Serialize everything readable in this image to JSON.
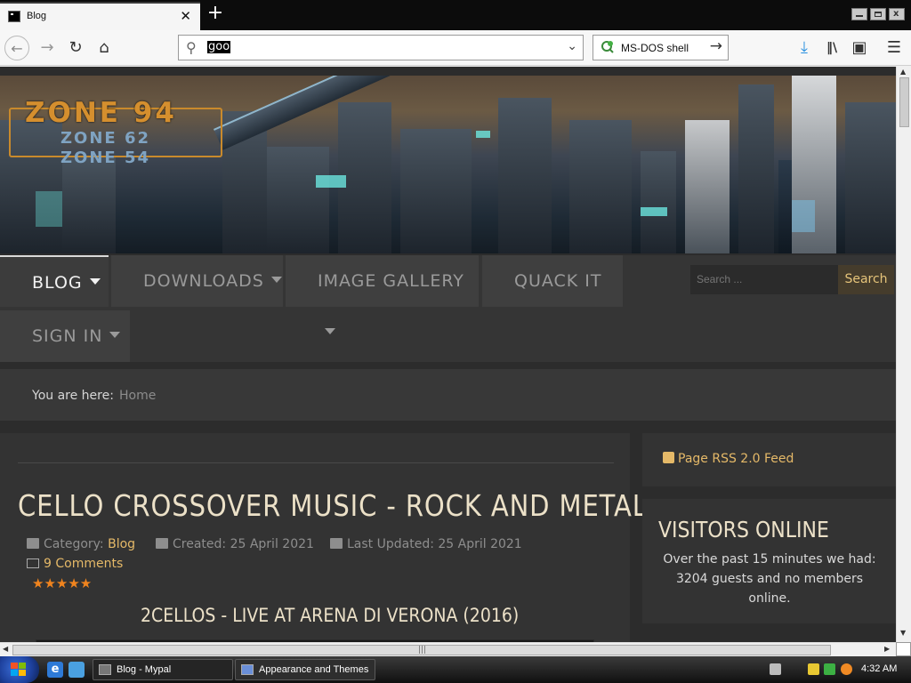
{
  "browser": {
    "tab": {
      "title": "Blog"
    },
    "url_text": "goo",
    "search_engine": "MS-DOS shell"
  },
  "site": {
    "logo": {
      "main": "ZONE 94",
      "sub1": "ZONE 62",
      "sub2": "ZONE 54"
    },
    "menu": [
      {
        "label": "BLOG",
        "dropdown": true,
        "active": true
      },
      {
        "label": "DOWNLOADS",
        "dropdown": true
      },
      {
        "label": "IMAGE GALLERY",
        "dropdown": true
      },
      {
        "label": "QUACK IT",
        "dropdown": false
      },
      {
        "label": "SIGN IN",
        "dropdown": true
      }
    ],
    "search": {
      "placeholder": "Search ...",
      "button": "Search"
    },
    "breadcrumb": {
      "label": "You are here:",
      "current": "Home"
    },
    "article": {
      "title": "CELLO CROSSOVER MUSIC - ROCK AND METAL",
      "category_label": "Category:",
      "category": "Blog",
      "created": "Created: 25 April 2021",
      "updated": "Last Updated: 25 April 2021",
      "comments": "9 Comments",
      "stars": "★★★★★",
      "rating": 5,
      "video_title": "2CELLOS - LIVE AT ARENA DI VERONA (2016)"
    },
    "sidebar": {
      "rss": "Page RSS 2.0 Feed",
      "visitors_title": "VISITORS ONLINE",
      "visitors_text": "Over the past 15 minutes we had: 3204 guests and no members online."
    }
  },
  "taskbar": {
    "tasks": [
      {
        "label": "Blog - Mypal"
      },
      {
        "label": "Appearance and Themes"
      }
    ],
    "clock": "4:32 AM"
  },
  "colors": {
    "accent": "#e5b968",
    "page_bg": "#2c2c2c",
    "title_text": "#ece1c8",
    "stars": "#f0841e"
  }
}
